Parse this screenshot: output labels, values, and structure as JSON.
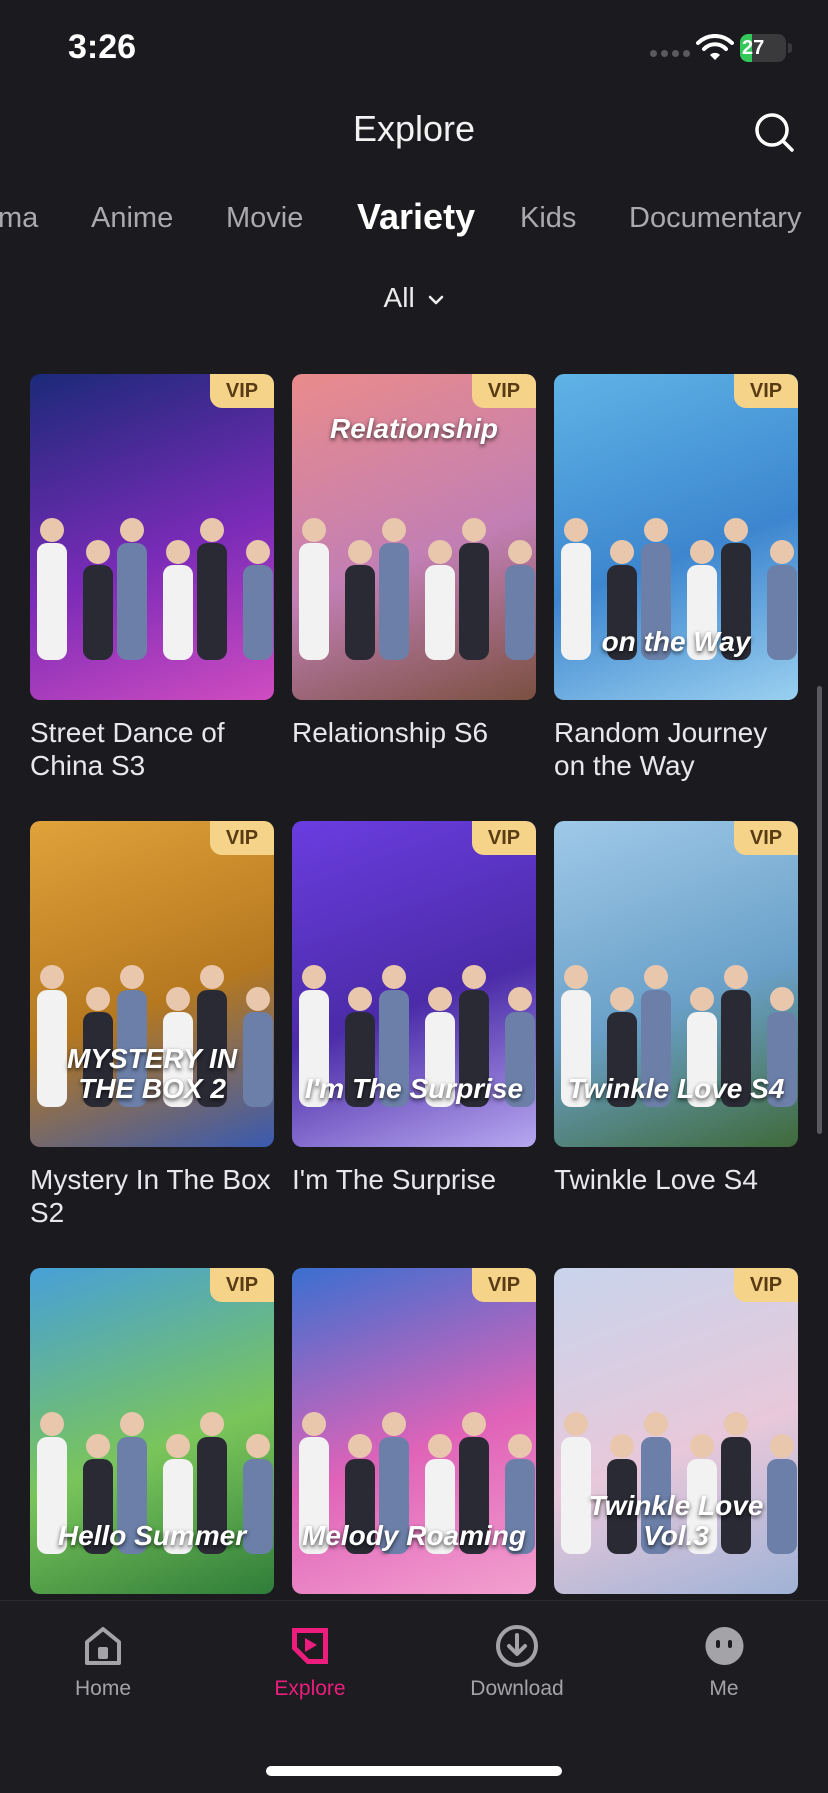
{
  "status_bar": {
    "time": "3:26",
    "battery": "27",
    "battery_level": 0.27
  },
  "header": {
    "title": "Explore",
    "search_icon": "search-icon"
  },
  "tabs": [
    {
      "label": "ma"
    },
    {
      "label": "Anime"
    },
    {
      "label": "Movie"
    },
    {
      "label": "Variety",
      "active": true
    },
    {
      "label": "Kids"
    },
    {
      "label": "Documentary"
    }
  ],
  "filter": {
    "label": "All"
  },
  "badge": "VIP",
  "cards": [
    {
      "title": "Street Dance of China S3",
      "poster_text": "",
      "colors": [
        "#1b2a78",
        "#7a2bb8",
        "#d04cc0"
      ]
    },
    {
      "title": "Relationship S6",
      "poster_text": "Relationship",
      "colors": [
        "#e98b8b",
        "#c27fb4",
        "#7a5040"
      ]
    },
    {
      "title": "Random Journey on the Way",
      "poster_text": "on the Way",
      "colors": [
        "#5fb3e6",
        "#3d86cf",
        "#9ad0f0"
      ]
    },
    {
      "title": "Mystery In The Box S2",
      "poster_text": "MYSTERY IN THE BOX 2",
      "colors": [
        "#e0a23a",
        "#b5781f",
        "#3a5ab0"
      ]
    },
    {
      "title": "I'm The Surprise",
      "poster_text": "I'm The Surprise",
      "colors": [
        "#6a3de0",
        "#4b2ba8",
        "#b7a8f0"
      ]
    },
    {
      "title": "Twinkle Love S4",
      "poster_text": "Twinkle Love S4",
      "colors": [
        "#9fc9e8",
        "#6aa0c8",
        "#3f6a3a"
      ]
    },
    {
      "title": "",
      "poster_text": "Hello Summer",
      "colors": [
        "#47a0d8",
        "#7ac55a",
        "#2f7d3a"
      ]
    },
    {
      "title": "",
      "poster_text": "Melody Roaming",
      "colors": [
        "#3a6fd0",
        "#e063b8",
        "#f3a0d0"
      ]
    },
    {
      "title": "",
      "poster_text": "Twinkle Love Vol.3",
      "colors": [
        "#c8d4ec",
        "#e8c8da",
        "#9fb2d6"
      ]
    }
  ],
  "nav": [
    {
      "label": "Home",
      "icon": "home-icon"
    },
    {
      "label": "Explore",
      "icon": "explore-icon",
      "active": true
    },
    {
      "label": "Download",
      "icon": "download-icon"
    },
    {
      "label": "Me",
      "icon": "me-icon"
    }
  ],
  "colors": {
    "accent": "#ec1d7d",
    "vip_bg": "#f5d48a",
    "background": "#1a1a1f"
  }
}
